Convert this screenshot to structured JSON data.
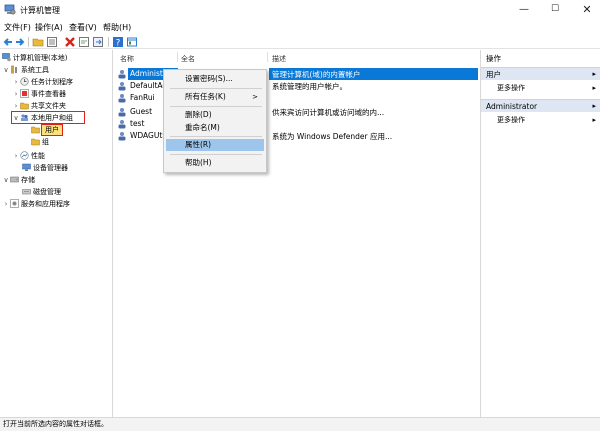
{
  "window": {
    "title": "计算机管理",
    "minimize": "—",
    "maximize": "☐",
    "close": "✕"
  },
  "menu": [
    "文件(F)",
    "操作(A)",
    "查看(V)",
    "帮助(H)"
  ],
  "toolbar": [
    "back-arrow-icon",
    "forward-arrow-icon",
    "folder-icon",
    "properties-list-icon",
    "delete-x-icon",
    "refresh-icon",
    "export-icon",
    "help-icon",
    "view-icon"
  ],
  "tree": {
    "root": "计算机管理(本地)",
    "system_tools": "系统工具",
    "task_scheduler": "任务计划程序",
    "event_viewer": "事件查看器",
    "shared_folders": "共享文件夹",
    "local_users_groups": "本地用户和组",
    "users": "用户",
    "groups": "组",
    "performance": "性能",
    "device_manager": "设备管理器",
    "storage": "存储",
    "disk_management": "磁盘管理",
    "services_apps": "服务和应用程序"
  },
  "list": {
    "columns": [
      "名称",
      "全名",
      "描述"
    ],
    "rows": [
      {
        "name": "Administ",
        "description": "管理计算机(域)的内置帐户"
      },
      {
        "name": "DefaultAc",
        "description": "系统管理的用户帐户。"
      },
      {
        "name": "FanRui",
        "description": ""
      },
      {
        "name": "Guest",
        "description": "供来宾访问计算机或访问域的内..."
      },
      {
        "name": "test",
        "description": ""
      },
      {
        "name": "WDAGUtil",
        "description": "系统为 Windows Defender 应用..."
      }
    ]
  },
  "context_menu": {
    "set_password": "设置密码(S)...",
    "all_tasks": "所有任务(K)",
    "delete": "删除(D)",
    "rename": "重命名(M)",
    "properties": "属性(R)",
    "help": "帮助(H)",
    "submenu_arrow": ">"
  },
  "actions": {
    "title": "操作",
    "section_users": "用户",
    "more_actions_1": "更多操作",
    "section_admin": "Administrator",
    "more_actions_2": "更多操作",
    "arrow": "▸"
  },
  "statusbar": "打开当前所选内容的属性对话框。",
  "colors": {
    "selection": "#0a78d7",
    "hover": "#9ec6ec",
    "highlight_box": "#e0201a",
    "selected_folder": "#fbe27a",
    "action_section": "#dde6f2"
  }
}
